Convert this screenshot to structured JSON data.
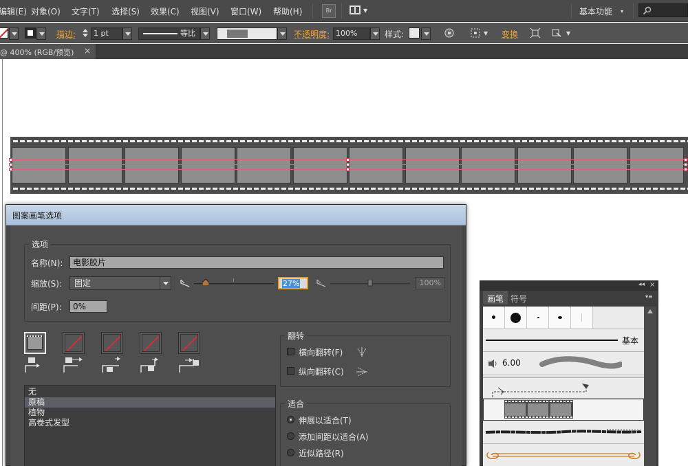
{
  "menu": {
    "items": [
      "编辑(E)",
      "对象(O)",
      "文字(T)",
      "选择(S)",
      "效果(C)",
      "视图(V)",
      "窗口(W)",
      "帮助(H)"
    ],
    "bridge_label": "Br",
    "workspace": "基本功能"
  },
  "control": {
    "stroke_label": "描边:",
    "stroke_weight": "1 pt",
    "profile_label": "等比",
    "opacity_label": "不透明度:",
    "opacity_value": "100%",
    "style_label": "样式:",
    "transform_label": "变换"
  },
  "document": {
    "tab_title": "@ 400% (RGB/预览)",
    "close_symbol": "×"
  },
  "dialog": {
    "title": "图案画笔选项",
    "options_group": "选项",
    "name_label": "名称(N):",
    "name_value": "电影胶片",
    "scale_label": "缩放(S):",
    "scale_mode": "固定",
    "scale_value": "27%",
    "scale_max": "100%",
    "spacing_label": "间距(P):",
    "spacing_value": "0%",
    "pattern_list": [
      "无",
      "原稿",
      "植物",
      "高卷式发型"
    ],
    "pattern_selected_index": 1,
    "flip_group": "翻转",
    "flip_horizontal": "横向翻转(F)",
    "flip_vertical": "纵向翻转(C)",
    "fit_group": "适合",
    "fit_options": [
      "伸展以适合(T)",
      "添加间距以适合(A)",
      "近似路径(R)"
    ],
    "fit_selected_index": 0
  },
  "brush_panel": {
    "tabs": [
      "画笔",
      "符号"
    ],
    "active_tab": "画笔",
    "basic_label": "基本",
    "brush_size": "6.00",
    "collapse_symbol": "◂◂",
    "close_symbol": "×"
  },
  "colors": {
    "accent_orange": "#f0a030",
    "selection_red": "#e06070",
    "dialog_bg": "#4e4e4e",
    "highlight_blue": "#4a90d9"
  }
}
